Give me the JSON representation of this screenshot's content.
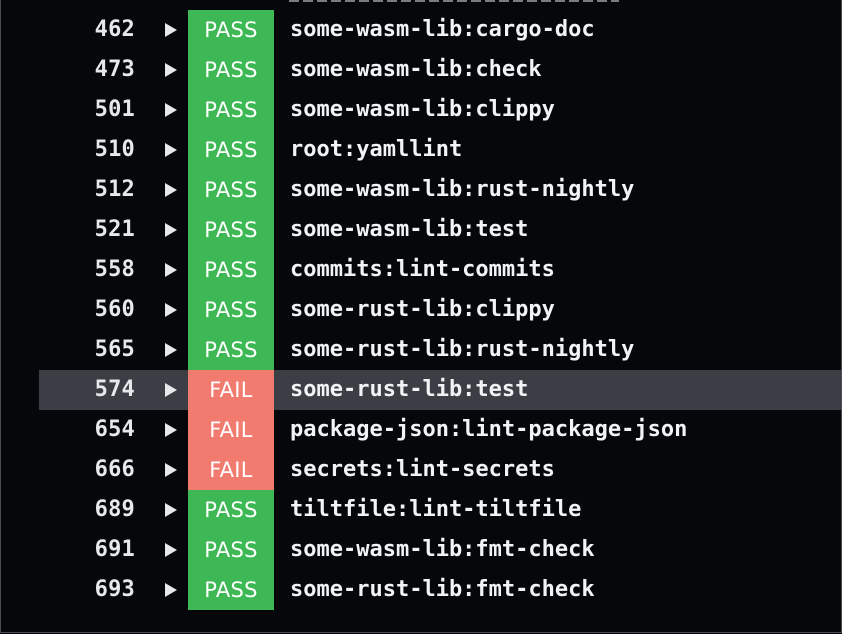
{
  "colors": {
    "background": "#05070b",
    "pass": "#3eb854",
    "fail": "#f27b70",
    "selected_row": "#3b3f45",
    "text": "#f1f3f5"
  },
  "icons": {
    "expand": "triangle-right-icon"
  },
  "selected_index": 9,
  "jobs": [
    {
      "id": "462",
      "status": "PASS",
      "name": "some-wasm-lib:cargo-doc"
    },
    {
      "id": "473",
      "status": "PASS",
      "name": "some-wasm-lib:check"
    },
    {
      "id": "501",
      "status": "PASS",
      "name": "some-wasm-lib:clippy"
    },
    {
      "id": "510",
      "status": "PASS",
      "name": "root:yamllint"
    },
    {
      "id": "512",
      "status": "PASS",
      "name": "some-wasm-lib:rust-nightly"
    },
    {
      "id": "521",
      "status": "PASS",
      "name": "some-wasm-lib:test"
    },
    {
      "id": "558",
      "status": "PASS",
      "name": "commits:lint-commits"
    },
    {
      "id": "560",
      "status": "PASS",
      "name": "some-rust-lib:clippy"
    },
    {
      "id": "565",
      "status": "PASS",
      "name": "some-rust-lib:rust-nightly"
    },
    {
      "id": "574",
      "status": "FAIL",
      "name": "some-rust-lib:test"
    },
    {
      "id": "654",
      "status": "FAIL",
      "name": "package-json:lint-package-json"
    },
    {
      "id": "666",
      "status": "FAIL",
      "name": "secrets:lint-secrets"
    },
    {
      "id": "689",
      "status": "PASS",
      "name": "tiltfile:lint-tiltfile"
    },
    {
      "id": "691",
      "status": "PASS",
      "name": "some-wasm-lib:fmt-check"
    },
    {
      "id": "693",
      "status": "PASS",
      "name": "some-rust-lib:fmt-check"
    }
  ]
}
